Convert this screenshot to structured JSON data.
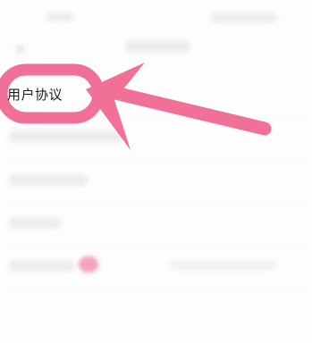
{
  "menu": {
    "highlighted_item_label": "用户协议"
  },
  "colors": {
    "annotation": "#f07097",
    "background": "#ffffff"
  }
}
